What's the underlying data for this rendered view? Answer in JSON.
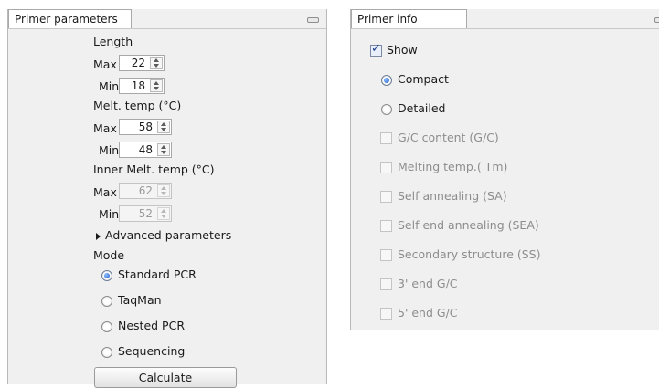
{
  "primer_parameters": {
    "tab_title": "Primer parameters",
    "length": {
      "heading": "Length",
      "max_label": "Max",
      "max_value": "22",
      "min_label": "Min",
      "min_value": "18"
    },
    "melt_temp": {
      "heading": "Melt. temp (°C)",
      "max_label": "Max",
      "max_value": "58",
      "min_label": "Min",
      "min_value": "48"
    },
    "inner_melt_temp": {
      "heading": "Inner Melt. temp (°C)",
      "max_label": "Max",
      "max_value": "62",
      "min_label": "Min",
      "min_value": "52"
    },
    "advanced_label": "Advanced parameters",
    "mode": {
      "heading": "Mode",
      "options": [
        "Standard PCR",
        "TaqMan",
        "Nested PCR",
        "Sequencing"
      ],
      "selected": "Standard PCR"
    },
    "calculate_label": "Calculate"
  },
  "primer_info": {
    "tab_title": "Primer info",
    "show_label": "Show",
    "show_checked": true,
    "view_options": [
      "Compact",
      "Detailed"
    ],
    "view_selected": "Compact",
    "fields": [
      "G/C content (G/C)",
      "Melting temp.( Tm)",
      "Self annealing (SA)",
      "Self end annealing (SEA)",
      "Secondary structure (SS)",
      "3' end G/C",
      "5' end G/C"
    ]
  },
  "colors": {
    "radio_selected": "#1f5cc8",
    "checkbox_tick": "#1c3f8f",
    "panel_bg": "#f0f0f0"
  }
}
